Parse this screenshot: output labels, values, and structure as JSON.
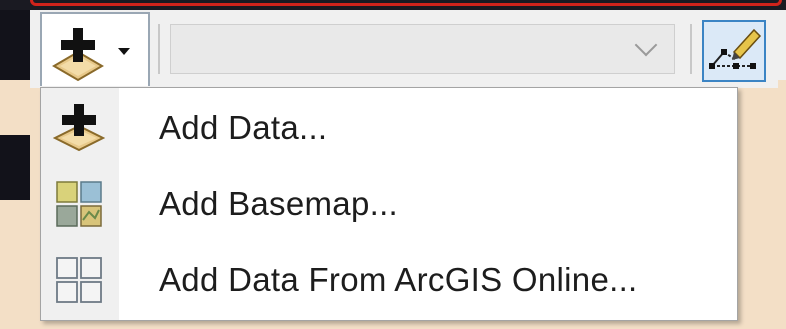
{
  "toolbar": {
    "add_data_button": {
      "icon": "add-data-icon",
      "dropdown_icon": "dropdown-arrow-icon"
    },
    "layer_select": {
      "value": "",
      "chevron_icon": "chevron-down-icon"
    },
    "editor_button": {
      "icon": "editor-pencil-icon"
    }
  },
  "menu": {
    "items": [
      {
        "label": "Add Data...",
        "icon": "add-data-icon"
      },
      {
        "label": "Add Basemap...",
        "icon": "basemap-grid-icon"
      },
      {
        "label": "Add Data From ArcGIS Online...",
        "icon": "arcgis-online-grid-icon"
      }
    ]
  },
  "colors": {
    "highlight_border": "#d0231b",
    "selected_button": "#3b84c4",
    "menu_text": "#1d1d1d"
  }
}
